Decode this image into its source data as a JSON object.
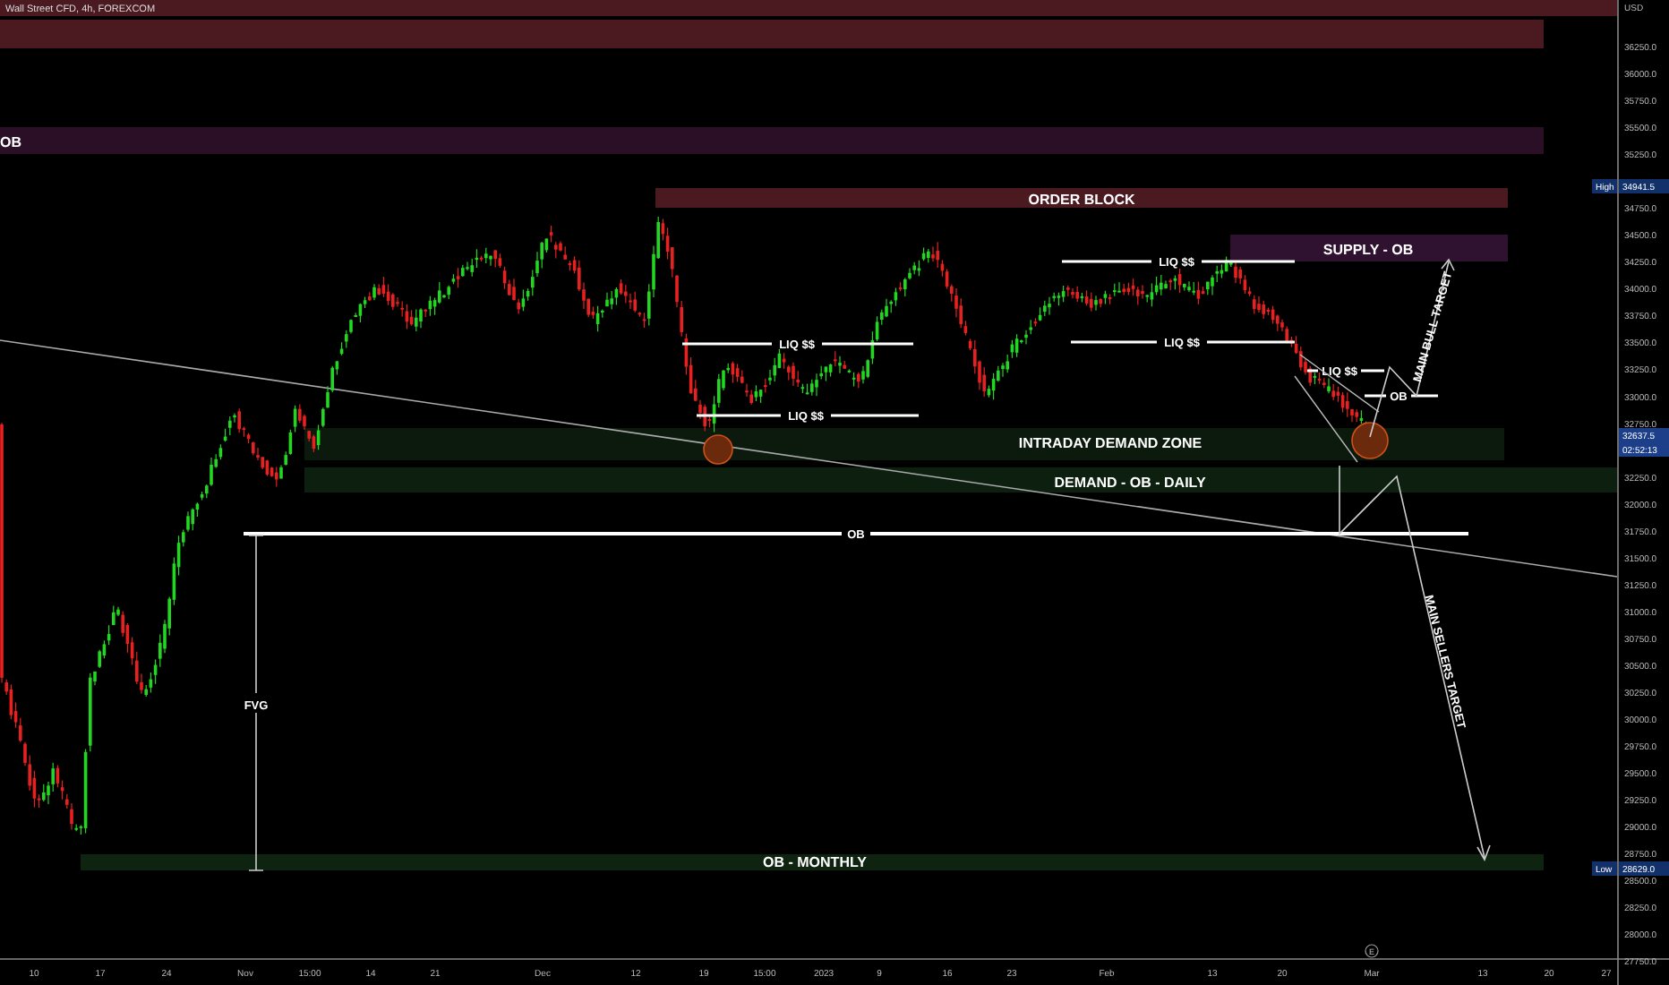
{
  "header": {
    "title": "Wall Street CFD, 4h, FOREXCOM"
  },
  "zones": [
    {
      "color": "#4a1a20"
    },
    {
      "color": "#4a1a20"
    },
    {
      "label": "OB",
      "color": "#2b0f26"
    },
    {
      "label": "ORDER BLOCK",
      "color": "#4a1a20"
    },
    {
      "label": "SUPPLY - OB",
      "color": "#2e1230"
    },
    {
      "label": "INTRADAY DEMAND ZONE",
      "color": "#0c1a0e"
    },
    {
      "label": "DEMAND - OB - DAILY",
      "color": "#0d200f"
    },
    {
      "label": "OB - MONTHLY",
      "color": "#0f2410"
    }
  ],
  "levels": [
    {
      "label": "LIQ $$"
    },
    {
      "label": "LIQ $$"
    },
    {
      "label": "LIQ $$"
    },
    {
      "label": "LIQ $$"
    },
    {
      "label": "LIQ $$"
    },
    {
      "label": "OB"
    },
    {
      "label": "OB"
    }
  ],
  "fvg": {
    "label": "FVG"
  },
  "targets": [
    {
      "label": "MAIN BULL TARGET"
    },
    {
      "label": "MAIN SELLERS TARGET"
    }
  ],
  "price_axis": {
    "currency": "USD",
    "ticks": [
      "36250.0",
      "36000.0",
      "35750.0",
      "35500.0",
      "35250.0",
      "34750.0",
      "34500.0",
      "34250.0",
      "34000.0",
      "33750.0",
      "33500.0",
      "33250.0",
      "33000.0",
      "32750.0",
      "32250.0",
      "32000.0",
      "31750.0",
      "31500.0",
      "31250.0",
      "31000.0",
      "30750.0",
      "30500.0",
      "30250.0",
      "30000.0",
      "29750.0",
      "29500.0",
      "29250.0",
      "29000.0",
      "28750.0",
      "28500.0",
      "28250.0",
      "28000.0",
      "27750.0"
    ],
    "high": {
      "label": "High",
      "value": "34941.5"
    },
    "last": {
      "price": "32637.5",
      "countdown": "02:52:13"
    },
    "low": {
      "label": "Low",
      "value": "28629.0"
    }
  },
  "time_axis": {
    "ticks": [
      "10",
      "17",
      "24",
      "Nov",
      "15:00",
      "14",
      "21",
      "Dec",
      "12",
      "19",
      "15:00",
      "2023",
      "9",
      "16",
      "23",
      "Feb",
      "13",
      "20",
      "Mar",
      "13",
      "20",
      "27"
    ],
    "event_marker": "E"
  }
}
